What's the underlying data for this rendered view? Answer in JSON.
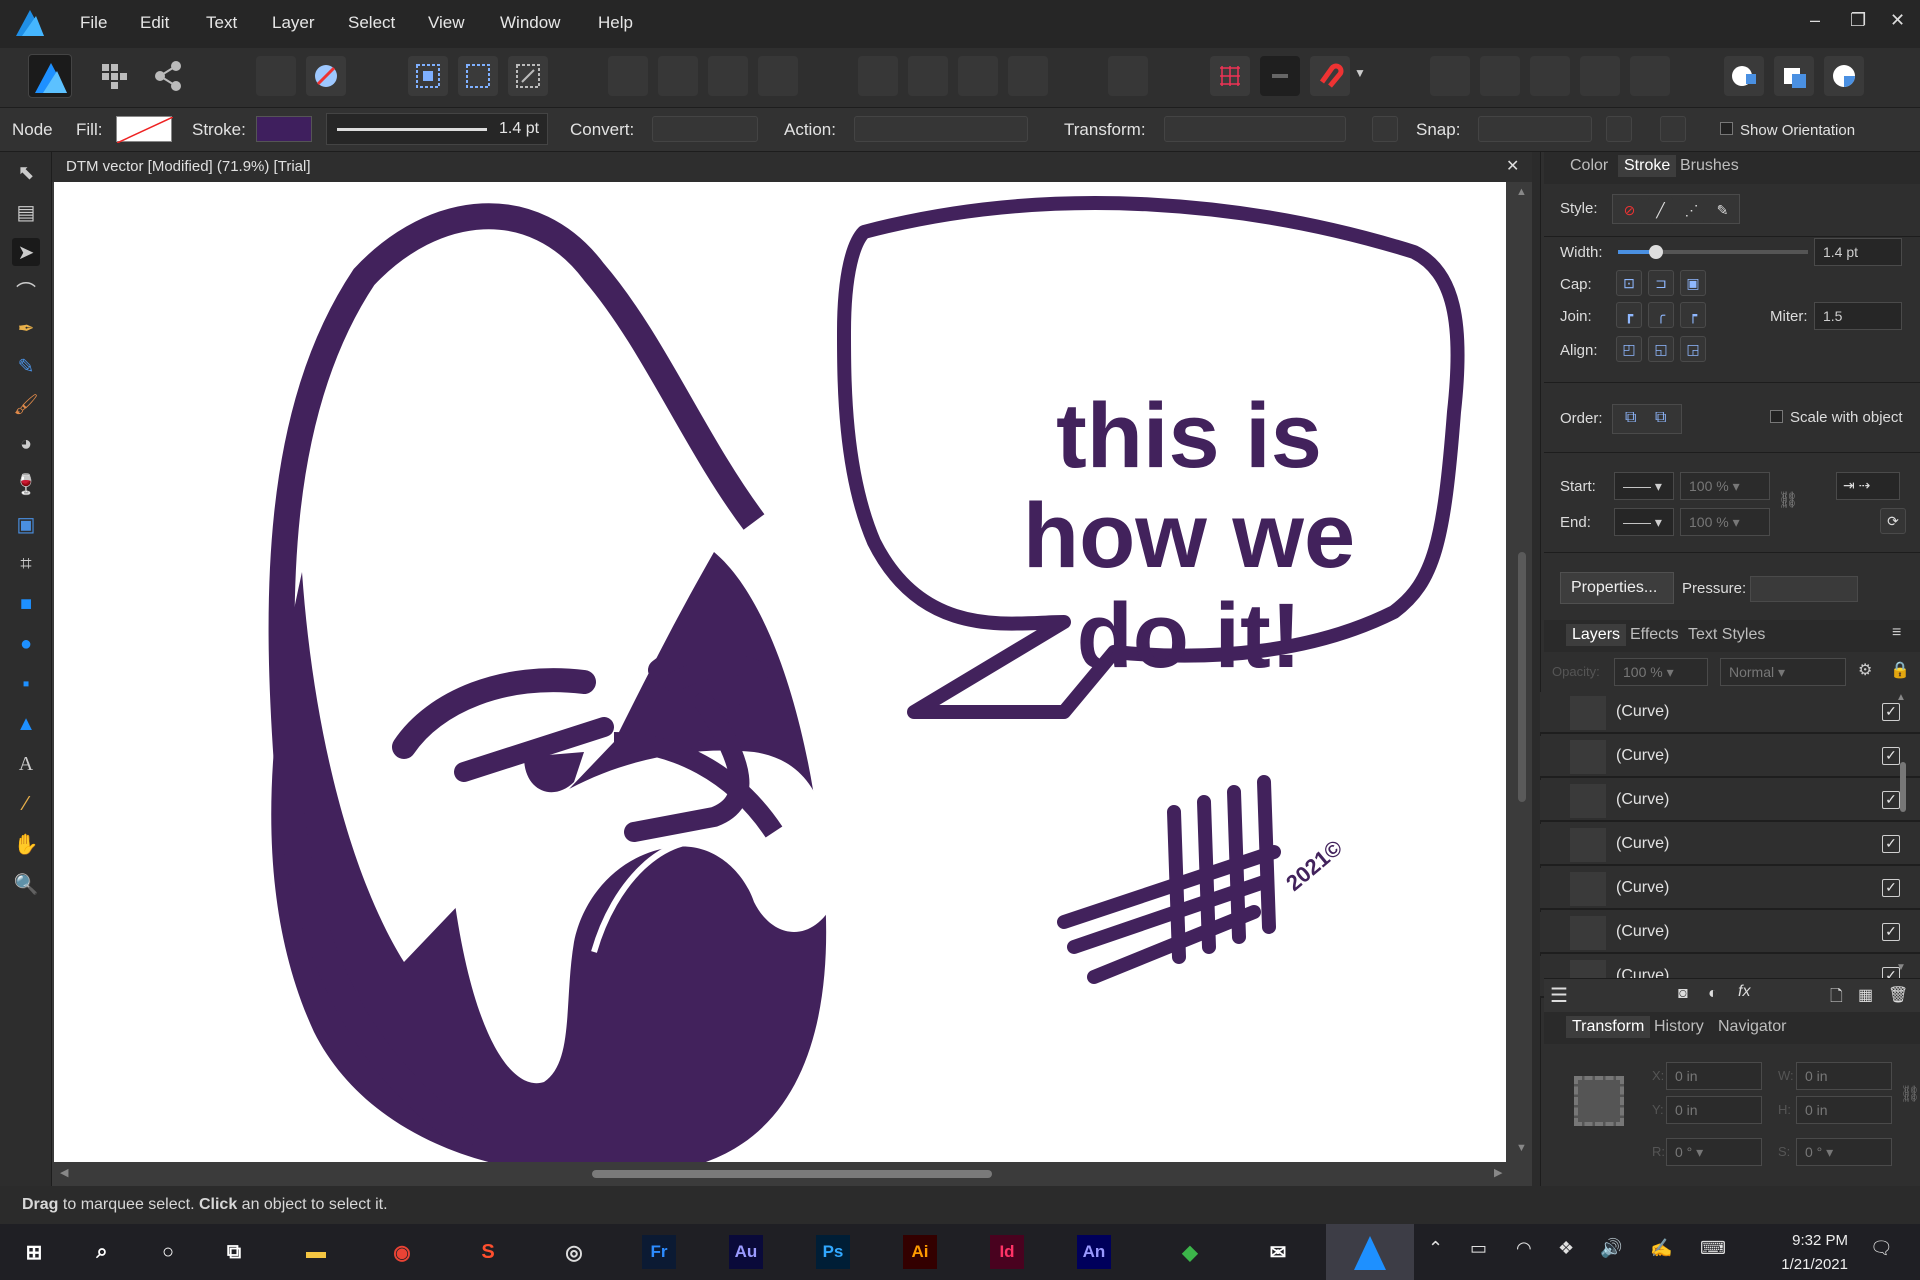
{
  "menubar": {
    "items": [
      "File",
      "Edit",
      "Text",
      "Layer",
      "Select",
      "View",
      "Window",
      "Help"
    ]
  },
  "context": {
    "mode": "Node",
    "fill_label": "Fill:",
    "stroke_label": "Stroke:",
    "stroke_width": "1.4 pt",
    "convert_label": "Convert:",
    "action_label": "Action:",
    "transform_label": "Transform:",
    "snap_label": "Snap:",
    "show_orientation": "Show Orientation",
    "stroke_color": "#3f1f5e"
  },
  "document": {
    "tab_title": "DTM vector [Modified] (71.9%) [Trial]",
    "speech_lines": [
      "this is",
      "how we",
      "do it!"
    ],
    "signature_year": "2021©",
    "art_color": "#42225c"
  },
  "stroke_panel": {
    "tabs": [
      "Color",
      "Stroke",
      "Brushes"
    ],
    "active_tab": "Stroke",
    "style_label": "Style:",
    "width_label": "Width:",
    "width_value": "1.4 pt",
    "width_fraction": 0.2,
    "cap_label": "Cap:",
    "join_label": "Join:",
    "miter_label": "Miter:",
    "miter_value": "1.5",
    "align_label": "Align:",
    "order_label": "Order:",
    "scale_with_object": "Scale with object",
    "start_label": "Start:",
    "end_label": "End:",
    "start_pct": "100 %",
    "end_pct": "100 %",
    "properties_button": "Properties...",
    "pressure_label": "Pressure:"
  },
  "layers_panel": {
    "tabs": [
      "Layers",
      "Effects",
      "Text Styles"
    ],
    "active_tab": "Layers",
    "opacity_label": "Opacity:",
    "opacity_value": "100 %",
    "blend_mode": "Normal",
    "rows": [
      "(Curve)",
      "(Curve)",
      "(Curve)",
      "(Curve)",
      "(Curve)",
      "(Curve)",
      "(Curve)"
    ]
  },
  "transform_panel": {
    "tabs": [
      "Transform",
      "History",
      "Navigator"
    ],
    "active_tab": "Transform",
    "x_label": "X:",
    "x_value": "0 in",
    "y_label": "Y:",
    "y_value": "0 in",
    "w_label": "W:",
    "w_value": "0 in",
    "h_label": "H:",
    "h_value": "0 in",
    "r_label": "R:",
    "r_value": "0 °",
    "s_label": "S:",
    "s_value": "0 °"
  },
  "status": {
    "drag_bold": "Drag",
    "drag_text": " to marquee select. ",
    "click_bold": "Click",
    "click_text": " an object to select it."
  },
  "taskbar": {
    "apps": [
      {
        "label": "Fr",
        "color": "#2d8cff",
        "bg": "#0b1a33"
      },
      {
        "label": "Au",
        "color": "#9b9bff",
        "bg": "#0a0a3a"
      },
      {
        "label": "Ps",
        "color": "#31a8ff",
        "bg": "#001e36"
      },
      {
        "label": "Ai",
        "color": "#ff9a00",
        "bg": "#330000"
      },
      {
        "label": "Id",
        "color": "#ff3366",
        "bg": "#49021f"
      },
      {
        "label": "An",
        "color": "#9999ff",
        "bg": "#00005b"
      }
    ],
    "time": "9:32 PM",
    "date": "1/21/2021"
  }
}
